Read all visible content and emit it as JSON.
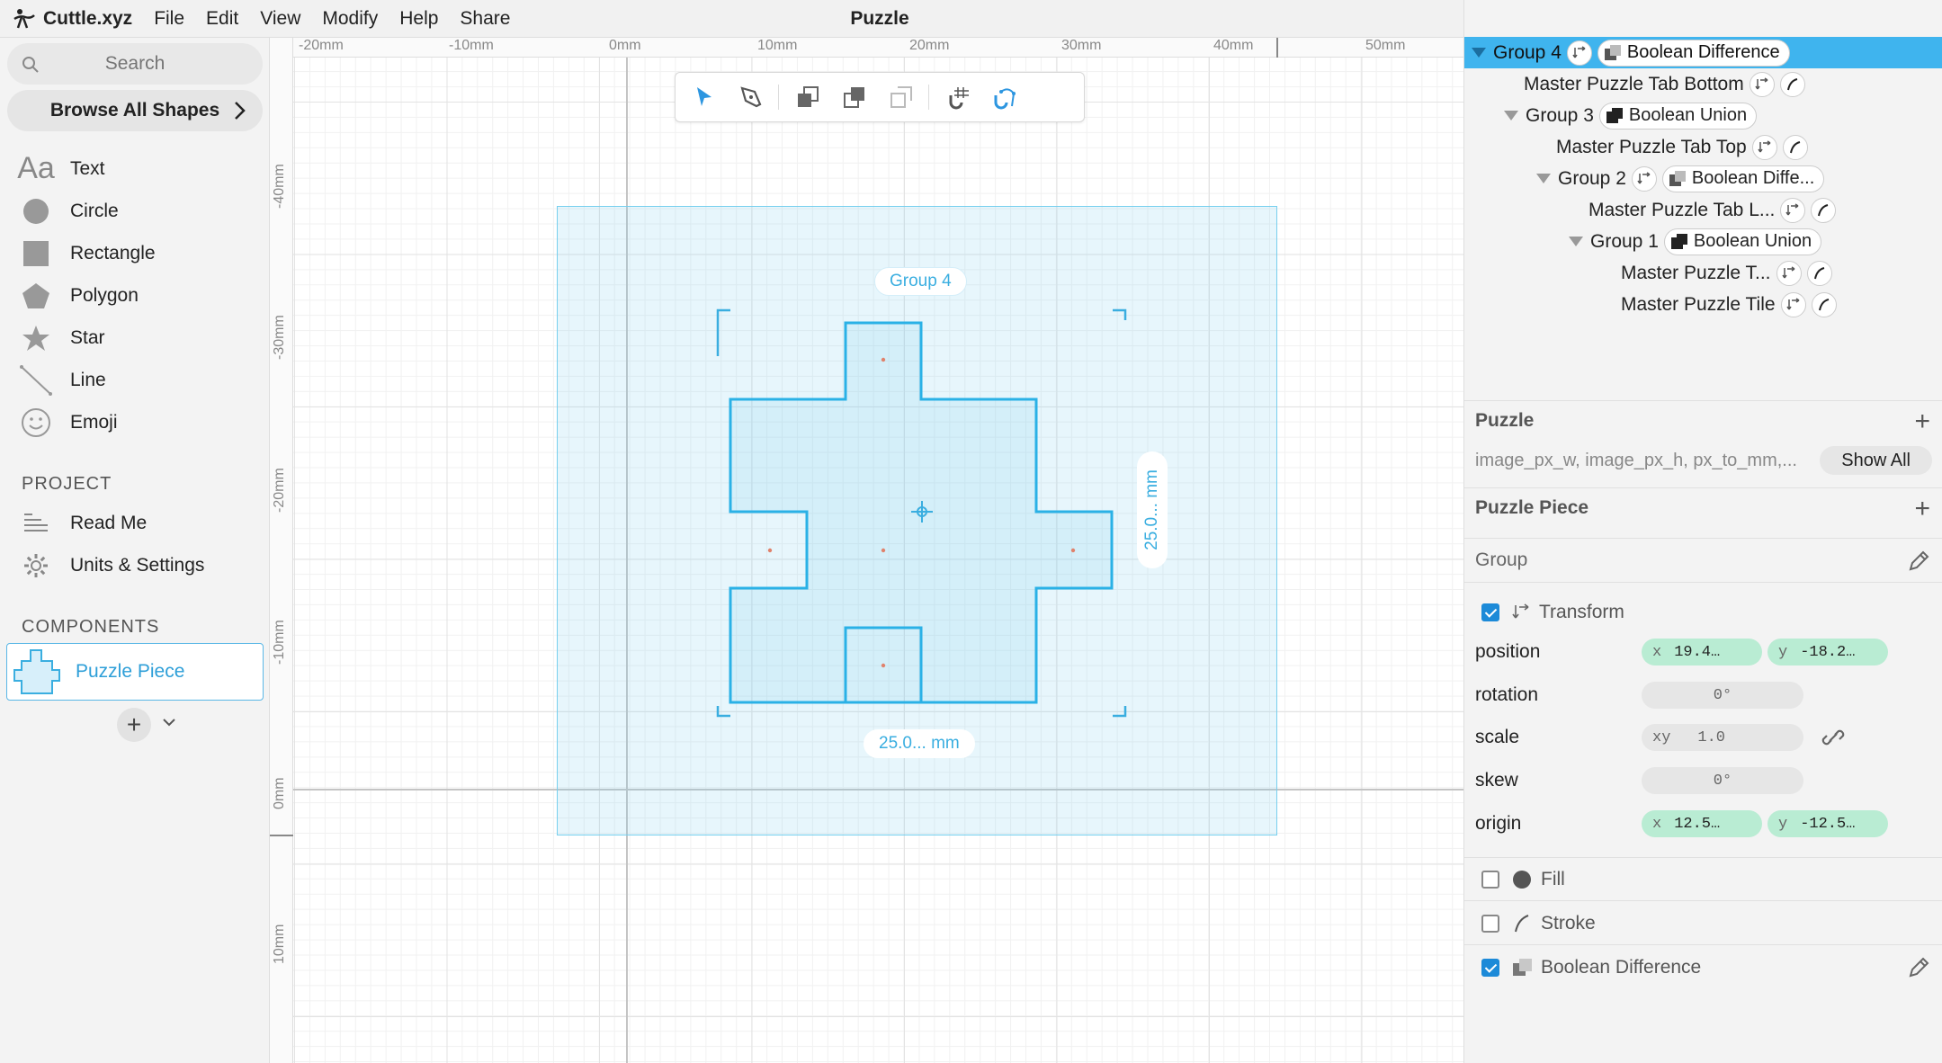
{
  "menubar": {
    "app_name": "Cuttle.xyz",
    "items": [
      "File",
      "Edit",
      "View",
      "Modify",
      "Help",
      "Share"
    ],
    "doc_title": "Puzzle"
  },
  "sidebar": {
    "search_placeholder": "Search",
    "browse_label": "Browse All Shapes",
    "shapes": [
      {
        "label": "Text",
        "icon": "text-icon"
      },
      {
        "label": "Circle",
        "icon": "circle-icon"
      },
      {
        "label": "Rectangle",
        "icon": "rectangle-icon"
      },
      {
        "label": "Polygon",
        "icon": "polygon-icon"
      },
      {
        "label": "Star",
        "icon": "star-icon"
      },
      {
        "label": "Line",
        "icon": "line-icon"
      },
      {
        "label": "Emoji",
        "icon": "emoji-icon"
      }
    ],
    "text_icon_glyph": "Aa",
    "project_label": "PROJECT",
    "project_items": [
      {
        "label": "Read Me",
        "icon": "readme-icon"
      },
      {
        "label": "Units & Settings",
        "icon": "gear-icon"
      }
    ],
    "components_label": "COMPONENTS",
    "component": "Puzzle Piece",
    "add_label": "+"
  },
  "canvas": {
    "ruler_top": [
      "-20mm",
      "-10mm",
      "0mm",
      "10mm",
      "20mm",
      "30mm",
      "40mm",
      "50mm"
    ],
    "ruler_left": [
      "-40mm",
      "-30mm",
      "-20mm",
      "-10mm",
      "0mm",
      "10mm"
    ],
    "group_badge": "Group 4",
    "width_label": "25.0... mm",
    "height_label": "25.0... mm",
    "accent": "#3aaee0"
  },
  "tree": {
    "rows": [
      {
        "label": "Group 4",
        "bool": "Boolean Difference",
        "selected": true
      },
      {
        "label": "Master Puzzle Tab Bottom"
      },
      {
        "label": "Group 3",
        "bool": "Boolean Union"
      },
      {
        "label": "Master Puzzle Tab Top"
      },
      {
        "label": "Group 2",
        "bool": "Boolean Diffe..."
      },
      {
        "label": "Master Puzzle Tab L..."
      },
      {
        "label": "Group 1",
        "bool": "Boolean Union"
      },
      {
        "label": "Master Puzzle T..."
      },
      {
        "label": "Master Puzzle Tile"
      }
    ]
  },
  "inspector": {
    "puzzle_section": "Puzzle",
    "params_text": "image_px_w, image_px_h, px_to_mm,...",
    "show_all": "Show All",
    "piece_section": "Puzzle Piece",
    "group_label": "Group",
    "transform_label": "Transform",
    "props": {
      "position": {
        "label": "position",
        "x": "19.4…",
        "y": "-18.2…"
      },
      "rotation": {
        "label": "rotation",
        "value": "0°"
      },
      "scale": {
        "label": "scale",
        "axis": "xy",
        "value": "1.0"
      },
      "skew": {
        "label": "skew",
        "value": "0°"
      },
      "origin": {
        "label": "origin",
        "x": "12.5…",
        "y": "-12.5…"
      }
    },
    "axis_x": "x",
    "axis_y": "y",
    "fill_label": "Fill",
    "stroke_label": "Stroke",
    "bool_label": "Boolean Difference",
    "transform_checked": true,
    "fill_checked": false,
    "stroke_checked": false,
    "bool_checked": true
  }
}
